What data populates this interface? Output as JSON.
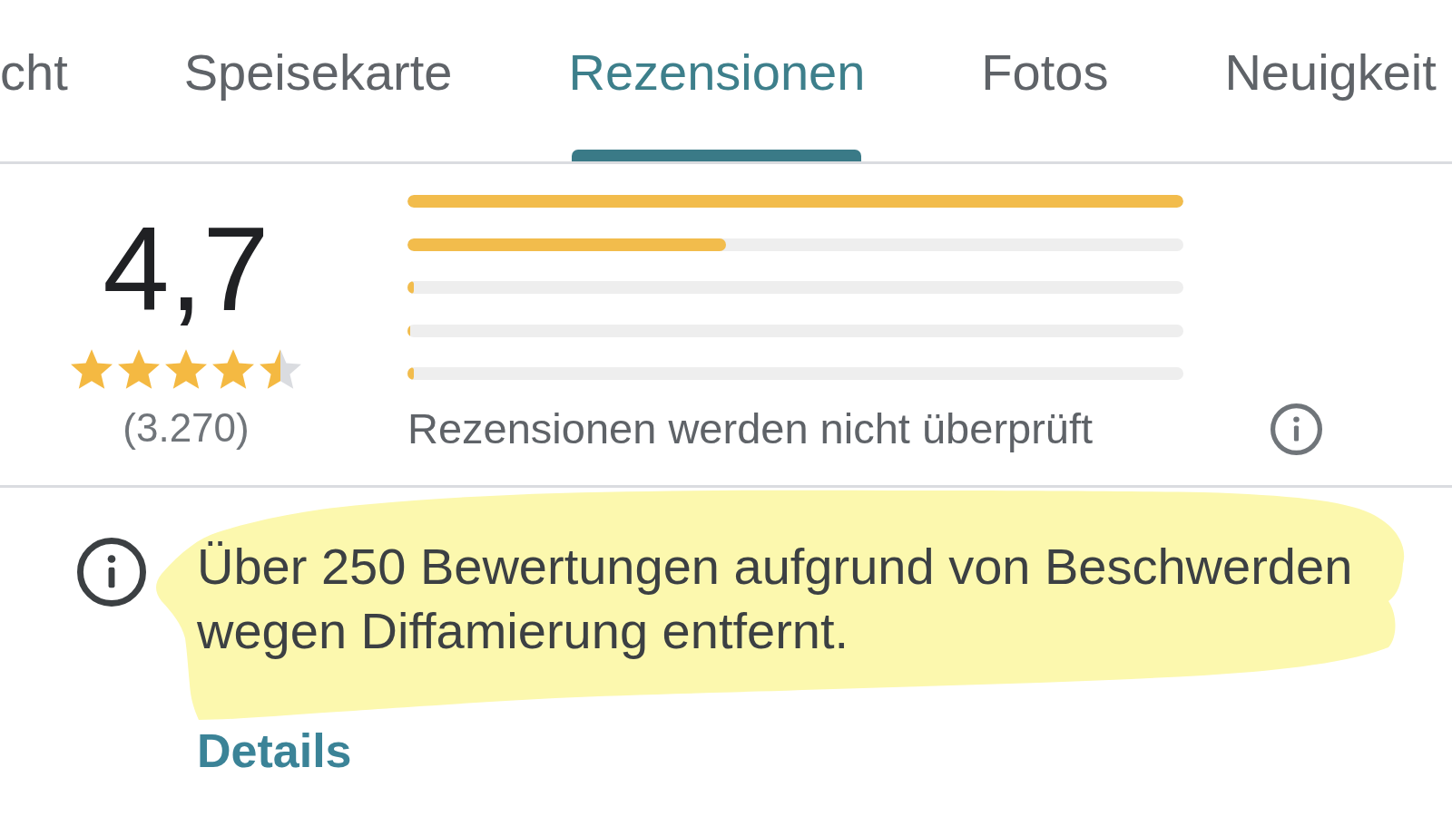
{
  "tabs": [
    {
      "label": "cht",
      "selected": false
    },
    {
      "label": "Speisekarte",
      "selected": false
    },
    {
      "label": "Rezensionen",
      "selected": true
    },
    {
      "label": "Fotos",
      "selected": false
    },
    {
      "label": "Neuigkeit",
      "selected": false
    }
  ],
  "rating": {
    "score": "4,7",
    "stars": 4.5,
    "count": "(3.270)"
  },
  "distribution": [
    {
      "level": 1
    },
    {
      "level": 0.41
    },
    {
      "level": 0.008
    },
    {
      "level": 0.003
    },
    {
      "level": 0.008
    }
  ],
  "review_note": {
    "text": "Rezensionen werden nicht überprüft"
  },
  "notice": {
    "text": "Über 250 Bewertungen aufgrund von Beschwerden wegen Diffamierung entfernt.",
    "highlighted": true,
    "link": "Details"
  }
}
